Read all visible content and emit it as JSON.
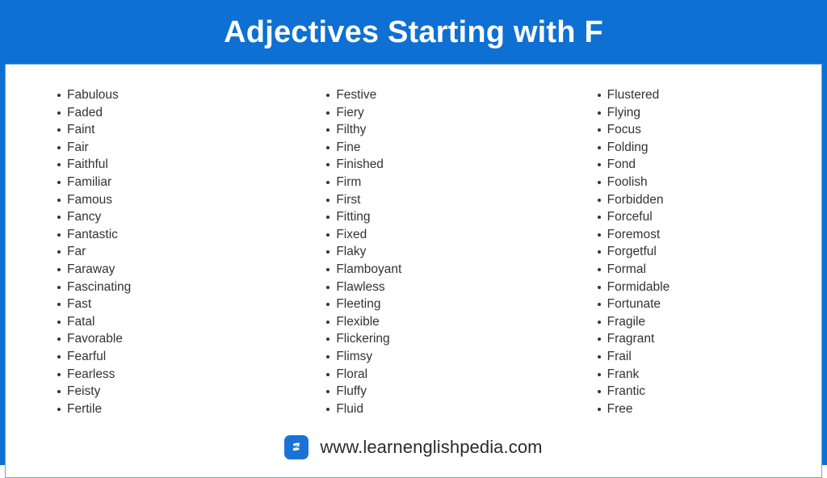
{
  "header": {
    "title": "Adjectives Starting with F",
    "background_color": "#0d70d2",
    "text_color": "#ffffff"
  },
  "content": {
    "border_color": "#6aa5df",
    "background_color": "#ffffff",
    "text_color": "#333333",
    "columns": [
      {
        "id": "column-1",
        "items": [
          "Fabulous",
          "Faded",
          "Faint",
          "Fair",
          "Faithful",
          "Familiar",
          "Famous",
          "Fancy",
          "Fantastic",
          "Far",
          "Faraway",
          "Fascinating",
          "Fast",
          "Fatal",
          "Favorable",
          "Fearful",
          "Fearless",
          "Feisty",
          "Fertile"
        ]
      },
      {
        "id": "column-2",
        "items": [
          "Festive",
          "Fiery",
          "Filthy",
          "Fine",
          "Finished",
          "Firm",
          "First",
          "Fitting",
          "Fixed",
          "Flaky",
          "Flamboyant",
          "Flawless",
          "Fleeting",
          "Flexible",
          "Flickering",
          "Flimsy",
          "Floral",
          "Fluffy",
          "Fluid"
        ]
      },
      {
        "id": "column-3",
        "items": [
          "Flustered",
          "Flying",
          "Focus",
          "Folding",
          "Fond",
          "Foolish",
          "Forbidden",
          "Forceful",
          "Foremost",
          "Forgetful",
          "Formal",
          "Formidable",
          "Fortunate",
          "Fragile",
          "Fragrant",
          "Frail",
          "Frank",
          "Frantic",
          "Free"
        ]
      }
    ]
  },
  "footer": {
    "logo_icon": "letter-e-logo-icon",
    "logo_letter": "E",
    "logo_background_color": "#1a73d4",
    "url": "www.learnenglishpedia.com"
  }
}
